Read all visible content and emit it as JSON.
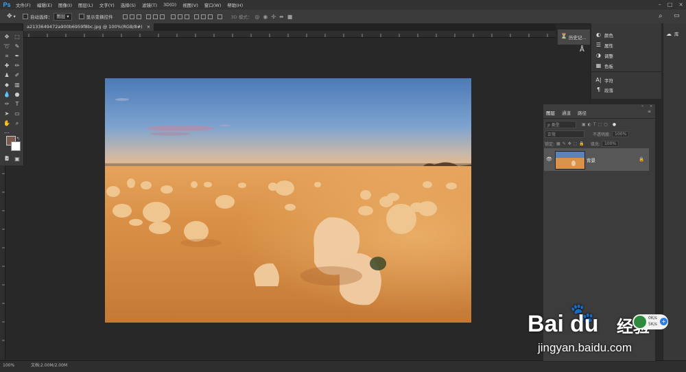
{
  "app": {
    "logo": "Ps"
  },
  "menu": [
    "文件(F)",
    "编辑(E)",
    "图像(I)",
    "图层(L)",
    "文字(Y)",
    "选择(S)",
    "滤镜(T)",
    "3D(D)",
    "视图(V)",
    "窗口(W)",
    "帮助(H)"
  ],
  "window_controls": [
    "–",
    "□",
    "×"
  ],
  "options": {
    "auto_select_label": "自动选择：",
    "auto_select_value": "图层",
    "show_transform_label": "显示变换控件",
    "mode_3d_label": "3D 模式："
  },
  "document": {
    "tab_title": "a2133649472a900b6959f8bc.jpg @ 100%(RGB/8#)",
    "close": "×"
  },
  "status": {
    "zoom": "100%",
    "doc_info": "文档:2.00M/2.00M"
  },
  "panels": {
    "history_label": "历史记...",
    "color_label": "颜色",
    "properties_label": "属性",
    "adjustments_label": "调整",
    "swatches_label": "色板",
    "character_label": "字符",
    "paragraph_label": "段落",
    "library_label": "库"
  },
  "layers": {
    "tabs": [
      "图层",
      "通道",
      "路径"
    ],
    "filter_kind": "ρ 类型",
    "blend_mode": "正常",
    "opacity_label": "不透明度:",
    "opacity_value": "100%",
    "lock_label": "锁定:",
    "fill_label": "填充:",
    "fill_value": "100%",
    "items": [
      {
        "name": "背景",
        "visible": true,
        "locked": true
      }
    ]
  },
  "colors": {
    "foreground": "#7d5a4f",
    "background": "#ffffff",
    "accent": "#31a8ff"
  },
  "watermark": {
    "brand": "Bai",
    "brand2": "du",
    "brand3": "经验",
    "url": "jingyan.baidu.com"
  },
  "network_speed": {
    "up": "0K/s",
    "down": "5K/s"
  }
}
